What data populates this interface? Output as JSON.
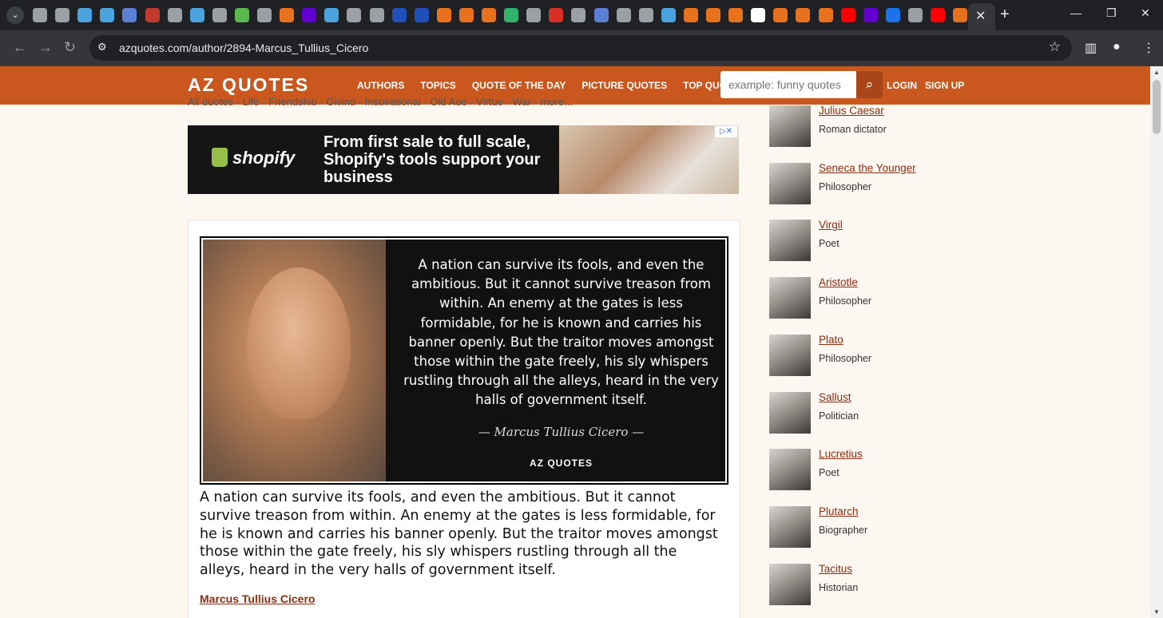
{
  "browser": {
    "tab_favicons": [
      {
        "icon": "globe-icon",
        "color": "#9aa0a6"
      },
      {
        "icon": "globe-icon",
        "color": "#9aa0a6"
      },
      {
        "icon": "shield-icon",
        "color": "#4aa3df"
      },
      {
        "icon": "shield-icon",
        "color": "#4aa3df"
      },
      {
        "icon": "arrow-icon",
        "color": "#5b7fd4"
      },
      {
        "icon": "bi-icon",
        "color": "#c0392b"
      },
      {
        "icon": "globe-icon",
        "color": "#9aa0a6"
      },
      {
        "icon": "search-icon",
        "color": "#4aa3df"
      },
      {
        "icon": "globe-icon",
        "color": "#9aa0a6"
      },
      {
        "icon": "play-icon",
        "color": "#59b84a"
      },
      {
        "icon": "globe-icon",
        "color": "#9aa0a6"
      },
      {
        "icon": "bookmark-icon",
        "color": "#e8711d"
      },
      {
        "icon": "yahoo-icon",
        "color": "#6001d2"
      },
      {
        "icon": "shield-icon",
        "color": "#4aa3df"
      },
      {
        "icon": "globe-icon",
        "color": "#9aa0a6"
      },
      {
        "icon": "globe-icon",
        "color": "#9aa0a6"
      },
      {
        "icon": "cube-icon",
        "color": "#1f4fb8"
      },
      {
        "icon": "cube-icon",
        "color": "#1f4fb8"
      },
      {
        "icon": "shield-icon",
        "color": "#e8711d"
      },
      {
        "icon": "shield-icon",
        "color": "#e8711d"
      },
      {
        "icon": "shield-icon",
        "color": "#e8711d"
      },
      {
        "icon": "g-icon",
        "color": "#2fb36b"
      },
      {
        "icon": "globe-icon",
        "color": "#9aa0a6"
      },
      {
        "icon": "pin-icon",
        "color": "#d93025"
      },
      {
        "icon": "text-icon",
        "color": "#9aa0a6"
      },
      {
        "icon": "arrow-icon",
        "color": "#5b7fd4"
      },
      {
        "icon": "globe-icon",
        "color": "#9aa0a6"
      },
      {
        "icon": "globe-icon",
        "color": "#9aa0a6"
      },
      {
        "icon": "search-icon",
        "color": "#4aa3df"
      },
      {
        "icon": "bookmark-icon",
        "color": "#e8711d"
      },
      {
        "icon": "bookmark-icon",
        "color": "#e8711d"
      },
      {
        "icon": "bookmark-icon",
        "color": "#e8711d"
      },
      {
        "icon": "wikipedia-icon",
        "color": "#ffffff"
      },
      {
        "icon": "bookmark-icon",
        "color": "#e8711d"
      },
      {
        "icon": "bookmark-icon",
        "color": "#e8711d"
      },
      {
        "icon": "bookmark-icon",
        "color": "#e8711d"
      },
      {
        "icon": "youtube-icon",
        "color": "#ff0000"
      },
      {
        "icon": "mail-icon",
        "color": "#6001d2"
      },
      {
        "icon": "circle-icon",
        "color": "#1a73e8"
      },
      {
        "icon": "text-icon",
        "color": "#9aa0a6"
      },
      {
        "icon": "youtube-icon",
        "color": "#ff0000"
      },
      {
        "icon": "bookmark-icon",
        "color": "#e8711d"
      }
    ],
    "url": "azquotes.com/author/2894-Marcus_Tullius_Cicero"
  },
  "site": {
    "logo": "AZ QUOTES",
    "brand_color": "#c9571e",
    "nav": [
      "AUTHORS",
      "TOPICS",
      "QUOTE OF THE DAY",
      "PICTURE QUOTES",
      "TOP QUOTES"
    ],
    "search_placeholder": "example: funny quotes",
    "login": "LOGIN",
    "signup": "SIGN UP"
  },
  "breadcrumbs": "All quotes · Life · Friendship · Giving · Inspirational · Old Age · Virtue · War · more...",
  "ad": {
    "brand": "shopify",
    "copy": "From first sale to full scale, Shopify's tools support your business"
  },
  "quote": {
    "image_text": "A nation can survive its fools, and even the ambitious. But it cannot survive treason from within. An enemy at the gates is less formidable, for he is known and carries his banner openly. But the traitor moves amongst those within the gate freely, his sly whispers rustling through all the alleys, heard in the very halls of government itself.",
    "image_author": "— Marcus Tullius Cicero —",
    "image_logo": "AZ QUOTES",
    "text": "A nation can survive its fools, and even the ambitious. But it cannot survive treason from within. An enemy at the gates is less formidable, for he is known and carries his banner openly. But the traitor moves amongst those within the gate freely, his sly whispers rustling through all the alleys, heard in the very halls of government itself.",
    "author": "Marcus Tullius Cicero"
  },
  "sidebar": [
    {
      "name": "Julius Caesar",
      "role": "Roman dictator"
    },
    {
      "name": "Seneca the Younger",
      "role": "Philosopher"
    },
    {
      "name": "Virgil",
      "role": "Poet"
    },
    {
      "name": "Aristotle",
      "role": "Philosopher"
    },
    {
      "name": "Plato",
      "role": "Philosopher"
    },
    {
      "name": "Sallust",
      "role": "Politician"
    },
    {
      "name": "Lucretius",
      "role": "Poet"
    },
    {
      "name": "Plutarch",
      "role": "Biographer"
    },
    {
      "name": "Tacitus",
      "role": "Historian"
    }
  ]
}
